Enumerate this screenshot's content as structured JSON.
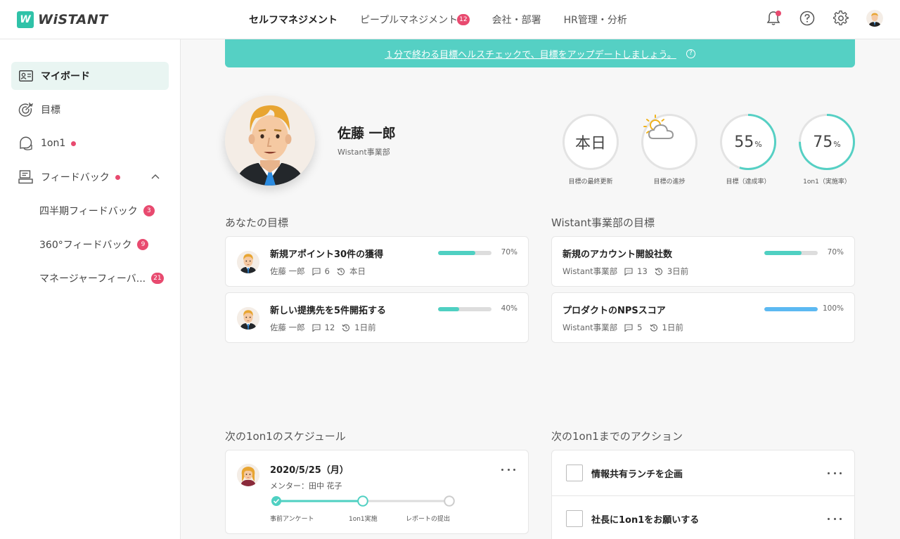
{
  "header": {
    "logo_mark": "W",
    "logo_text": "WiSTANT",
    "nav": [
      {
        "label": "セルフマネジメント",
        "badge": ""
      },
      {
        "label": "ピープルマネジメント",
        "badge": "12"
      },
      {
        "label": "会社・部署",
        "badge": ""
      },
      {
        "label": "HR管理・分析",
        "badge": ""
      }
    ],
    "icons": [
      "bell-icon",
      "help-icon",
      "gear-icon",
      "user-avatar"
    ]
  },
  "sidebar": {
    "items": [
      {
        "label": "マイボード",
        "icon": "id-card-icon"
      },
      {
        "label": "目標",
        "icon": "target-icon"
      },
      {
        "label": "1on1",
        "icon": "chat-icon"
      },
      {
        "label": "フィードバック",
        "icon": "feedback-icon"
      }
    ],
    "sub_items": [
      {
        "label": "四半期フィードバック",
        "badge": "3"
      },
      {
        "label": "360°フィードバック",
        "badge": "9"
      },
      {
        "label": "マネージャーフィーバ...",
        "badge": "21"
      }
    ]
  },
  "banner": {
    "text": "１分で終わる目標ヘルスチェックで、目標をアップデートしましょう。",
    "help": "?"
  },
  "profile": {
    "name": "佐藤 一郎",
    "department": "Wistant事業部"
  },
  "stats": [
    {
      "value": "本日",
      "unit": "",
      "label": "目標の最終更新",
      "progress": 0
    },
    {
      "value": "",
      "unit": "",
      "label": "目標の進捗",
      "icon": "partly-cloudy-icon",
      "progress": 0
    },
    {
      "value": "55",
      "unit": "%",
      "label": "目標（達成率）",
      "progress": 0.55
    },
    {
      "value": "75",
      "unit": "%",
      "label": "1on1（実施率）",
      "progress": 0.75
    }
  ],
  "my_goals": {
    "title": "あなたの目標",
    "items": [
      {
        "title": "新規アポイント30件の獲得",
        "owner": "佐藤 一郎",
        "comments": "6",
        "updated": "本日",
        "percent": "70%",
        "progress": 0.7
      },
      {
        "title": "新しい提携先を5件開拓する",
        "owner": "佐藤 一郎",
        "comments": "12",
        "updated": "1日前",
        "percent": "40%",
        "progress": 0.4
      }
    ]
  },
  "dept_goals": {
    "title": "Wistant事業部の目標",
    "items": [
      {
        "title": "新規のアカウント開設社数",
        "owner": "Wistant事業部",
        "comments": "13",
        "updated": "3日前",
        "percent": "70%",
        "progress": 0.7
      },
      {
        "title": "プロダクトのNPSスコア",
        "owner": "Wistant事業部",
        "comments": "5",
        "updated": "1日前",
        "percent": "100%",
        "progress": 1.0
      }
    ]
  },
  "schedule": {
    "title": "次の1on1のスケジュール",
    "date": "2020/5/25（月）",
    "mentor": "メンター：田中 花子",
    "steps": [
      "事前アンケート",
      "1on1実施",
      "レポートの提出"
    ]
  },
  "actions": {
    "title": "次の1on1までのアクション",
    "items": [
      "情報共有ランチを企画",
      "社長に1on1をお願いする"
    ]
  },
  "colors": {
    "accent": "#55d0c4",
    "brand": "#2fc2a8",
    "badge": "#e84a6f",
    "progress_blue": "#5cb9f2"
  }
}
